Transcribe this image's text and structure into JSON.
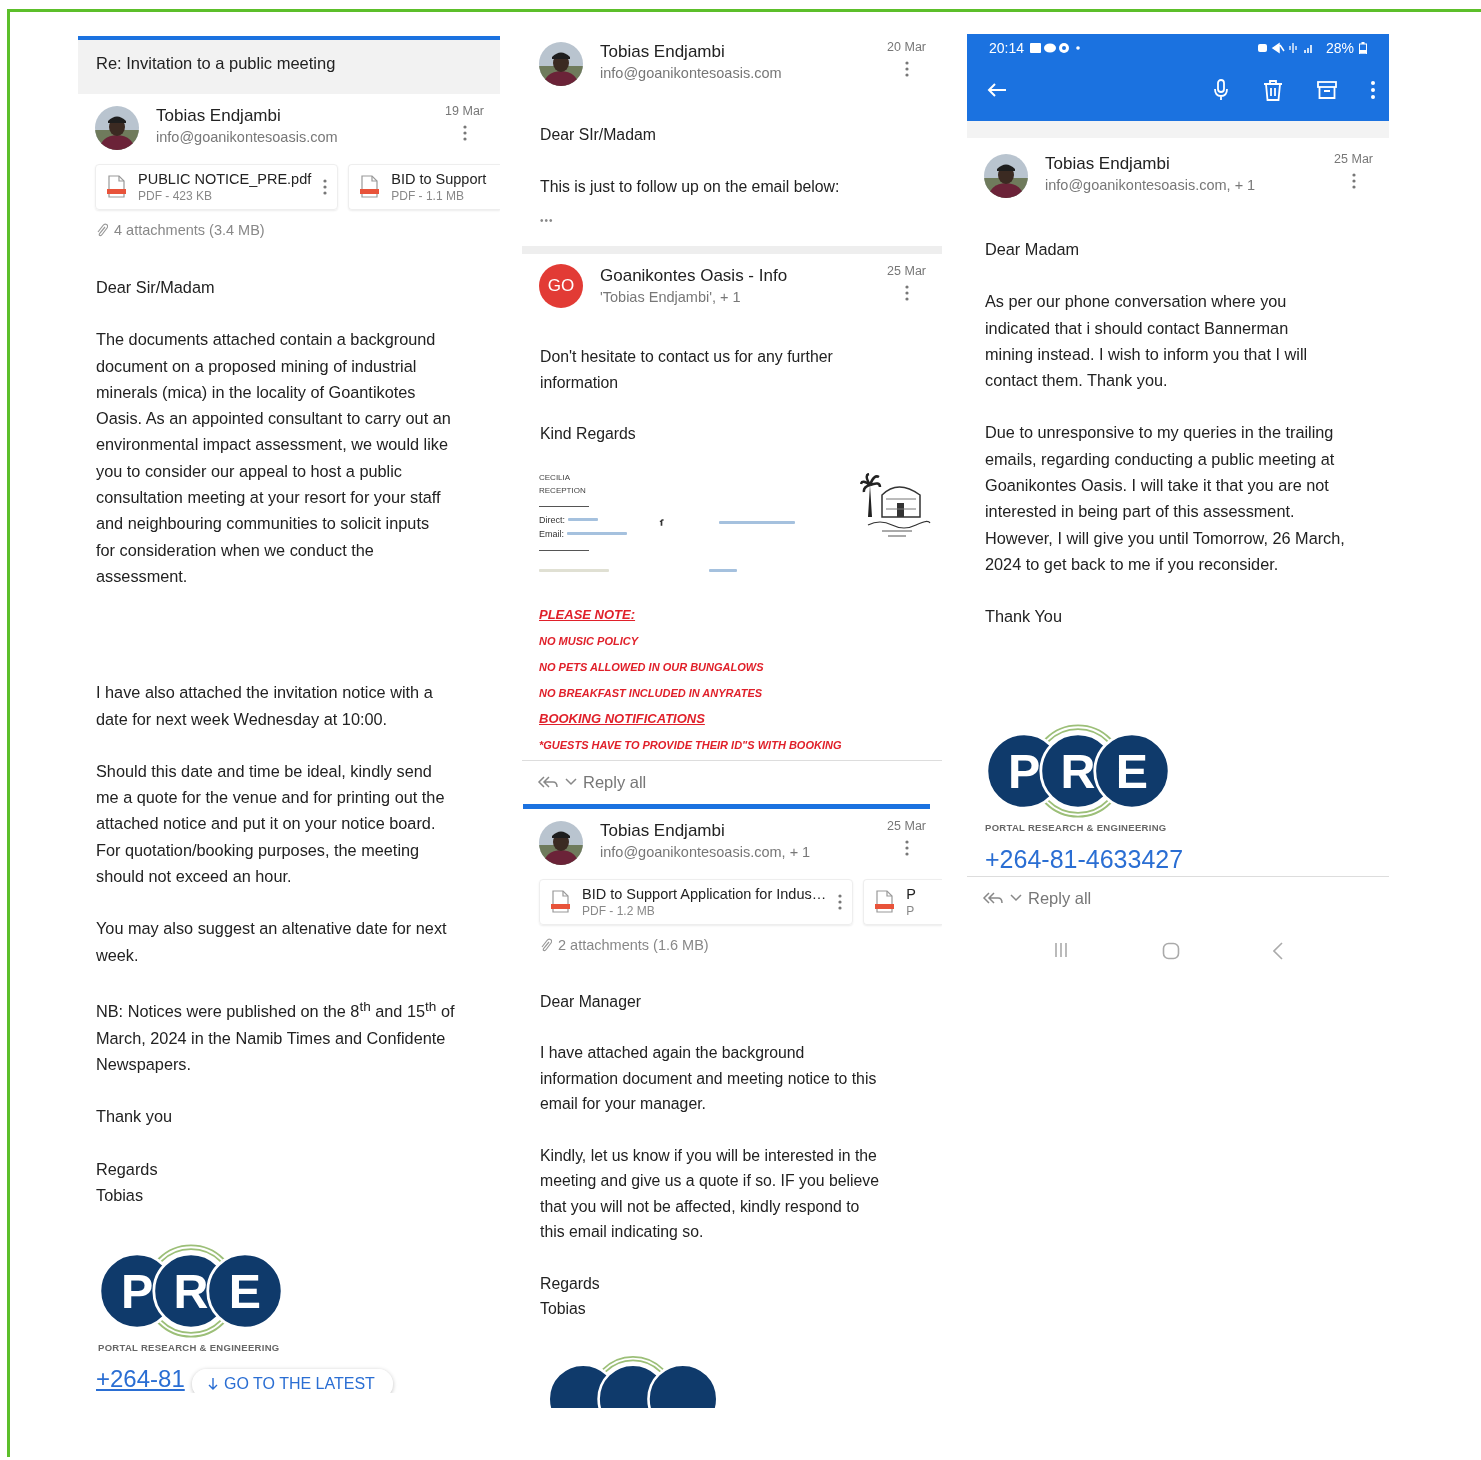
{
  "columns": [
    {
      "blocks": [
        {
          "kind": "subject",
          "text": "Re: Invitation to a public meeting"
        },
        {
          "kind": "header",
          "avatar": {
            "kind": "photo"
          },
          "name": "Tobias Endjambi",
          "address": "info@goanikontesoasis.com",
          "date": "19 Mar"
        },
        {
          "kind": "attachments",
          "files": [
            {
              "name": "PUBLIC NOTICE_PRE.pdf",
              "meta": "PDF - 423 KB"
            },
            {
              "name": "BID to Support",
              "meta": "PDF - 1.1 MB"
            }
          ],
          "summary": "4 attachments (3.4 MB)"
        },
        {
          "kind": "paragraph",
          "lines": [
            "Dear Sir/Madam"
          ]
        },
        {
          "kind": "paragraph",
          "lines": [
            "The documents attached contain a background",
            "document on a proposed mining of industrial",
            "minerals (mica) in the locality of Goantikotes",
            "Oasis. As an appointed consultant to carry out an",
            "environmental impact assessment, we would like",
            "you to consider our appeal to host a public",
            "consultation meeting at your resort for your staff",
            "and neighbouring communities to solicit inputs",
            "for consideration when we conduct the",
            "assessment."
          ]
        },
        {
          "kind": "spacer"
        },
        {
          "kind": "paragraph",
          "lines": [
            "I have also attached the invitation notice with a",
            "date for next week Wednesday at 10:00."
          ]
        },
        {
          "kind": "paragraph",
          "lines": [
            "Should this date and time be ideal, kindly  send",
            "me a quote for the venue and for printing out the",
            "attached notice and put it on your notice board.",
            "For quotation/booking purposes, the meeting",
            "should not exceed an hour."
          ]
        },
        {
          "kind": "paragraph",
          "lines": [
            "You may also suggest an altenative date for next",
            "week."
          ]
        },
        {
          "kind": "paragraph",
          "lines": [
            "NB: Notices were published on the 8$^{th}$ and 15$^{th}$ of",
            "March, 2024 in the Namib Times and Confidente",
            "Newspapers."
          ]
        },
        {
          "kind": "paragraph",
          "lines": [
            "Thank you"
          ]
        },
        {
          "kind": "paragraph",
          "lines": [
            "Regards",
            "Tobias"
          ]
        },
        {
          "kind": "logo",
          "letters": [
            "P",
            "R",
            "E"
          ],
          "tagline": "PORTAL RESEARCH & ENGINEERING"
        },
        {
          "kind": "phone",
          "text": "+264-81",
          "underlined": true,
          "overlay_button": {
            "label": "GO TO THE LATEST"
          }
        }
      ]
    },
    {
      "blocks": [
        {
          "kind": "header",
          "avatar": {
            "kind": "photo"
          },
          "name": "Tobias Endjambi",
          "address": "info@goanikontesoasis.com",
          "date": "20 Mar"
        },
        {
          "kind": "paragraph",
          "lines": [
            "Dear SIr/Madam"
          ]
        },
        {
          "kind": "paragraph",
          "lines": [
            "This is just to follow up on the email below:"
          ]
        },
        {
          "kind": "ellipsis",
          "text": "•••"
        },
        {
          "kind": "divider"
        },
        {
          "kind": "header",
          "avatar": {
            "kind": "initials",
            "initials": "GO"
          },
          "name": "Goanikontes Oasis - Info",
          "address": "'Tobias Endjambi', + 1",
          "date": "25 Mar"
        },
        {
          "kind": "paragraph",
          "lines": [
            "Don't hesitate to contact us for any further",
            "information"
          ]
        },
        {
          "kind": "paragraph",
          "lines": [
            "Kind Regards"
          ]
        },
        {
          "kind": "hotel_signature",
          "name": "CECILIA",
          "role": "RECEPTION",
          "direct_label": "Direct:",
          "email_label": "Email:"
        },
        {
          "kind": "notices",
          "items": [
            {
              "kind": "heading",
              "text": "PLEASE NOTE:"
            },
            {
              "kind": "item",
              "text": "NO MUSIC POLICY"
            },
            {
              "kind": "item",
              "text": "NO PETS ALLOWED IN OUR BUNGALOWS"
            },
            {
              "kind": "item",
              "text": "NO BREAKFAST INCLUDED IN ANYRATES"
            },
            {
              "kind": "heading",
              "text": "BOOKING NOTIFICATIONS"
            },
            {
              "kind": "item",
              "text": "*GUESTS HAVE TO PROVIDE THEIR ID\"S WITH BOOKING"
            }
          ]
        },
        {
          "kind": "reply_bar",
          "label": "Reply all"
        },
        {
          "kind": "accent_rule"
        },
        {
          "kind": "header",
          "avatar": {
            "kind": "photo"
          },
          "name": "Tobias Endjambi",
          "address": "info@goanikontesoasis.com, + 1",
          "date": "25 Mar"
        },
        {
          "kind": "attachments",
          "files": [
            {
              "name": "BID to Support Application for Indus…",
              "meta": "PDF - 1.2 MB"
            },
            {
              "name": "P",
              "meta": "P"
            }
          ],
          "summary": "2 attachments (1.6 MB)"
        },
        {
          "kind": "paragraph",
          "lines": [
            "Dear Manager"
          ]
        },
        {
          "kind": "paragraph",
          "lines": [
            "I have attached again the background",
            "information document and meeting notice to this",
            "email for your manager."
          ]
        },
        {
          "kind": "paragraph",
          "lines": [
            "Kindly, let us know if you will be interested in the",
            "meeting and give us a quote if so. IF you believe",
            "that you will not be affected, kindly respond to",
            "this email indicating so."
          ]
        },
        {
          "kind": "paragraph",
          "lines": [
            "Regards",
            "Tobias"
          ]
        },
        {
          "kind": "logo_cropped"
        }
      ]
    },
    {
      "blocks": [
        {
          "kind": "status_bar",
          "time": "20:14",
          "battery": "28%"
        },
        {
          "kind": "toolbar"
        },
        {
          "kind": "divider"
        },
        {
          "kind": "header",
          "avatar": {
            "kind": "photo"
          },
          "name": "Tobias Endjambi",
          "address": "info@goanikontesoasis.com, + 1",
          "date": "25 Mar"
        },
        {
          "kind": "paragraph",
          "lines": [
            "Dear Madam"
          ]
        },
        {
          "kind": "paragraph",
          "lines": [
            "As per our phone conversation where you",
            "indicated that i should contact Bannerman",
            "mining instead. I wish to inform you that I will",
            "contact them.  Thank you."
          ]
        },
        {
          "kind": "paragraph",
          "lines": [
            "Due to unresponsive to  my queries in the trailing",
            "emails, regarding conducting a public meeting at",
            "Goanikontes Oasis. I will take it that you are not",
            "interested in being part of this assessment.",
            "However, I will give you until Tomorrow, 26 March,",
            "2024 to get back to me if you reconsider."
          ]
        },
        {
          "kind": "paragraph",
          "lines": [
            "Thank You"
          ]
        },
        {
          "kind": "spacer"
        },
        {
          "kind": "logo",
          "letters": [
            "P",
            "R",
            "E"
          ],
          "tagline": "PORTAL RESEARCH & ENGINEERING"
        },
        {
          "kind": "phone",
          "text": "+264-81-4633427",
          "underlined": false
        },
        {
          "kind": "reply_bar",
          "label": "Reply all"
        },
        {
          "kind": "nav_bar"
        }
      ]
    }
  ]
}
